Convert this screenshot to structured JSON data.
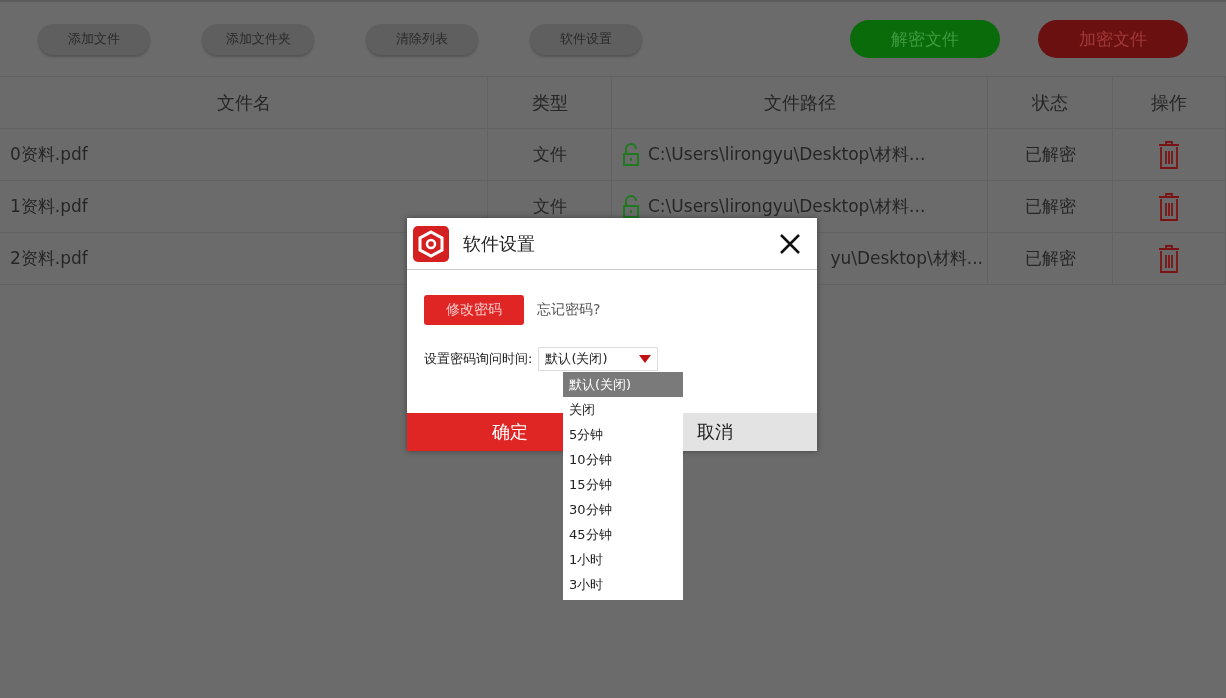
{
  "toolbar": {
    "buttons": [
      "添加文件",
      "添加文件夹",
      "清除列表",
      "软件设置"
    ],
    "decrypt_button": "解密文件",
    "encrypt_button": "加密文件"
  },
  "table": {
    "columns": [
      "文件名",
      "类型",
      "文件路径",
      "状态",
      "操作"
    ],
    "rows": [
      {
        "name": "0资料.pdf",
        "type": "文件",
        "path": "C:\\Users\\lirongyu\\Desktop\\材料...",
        "status": "已解密"
      },
      {
        "name": "1资料.pdf",
        "type": "文件",
        "path": "C:\\Users\\lirongyu\\Desktop\\材料...",
        "status": "已解密"
      },
      {
        "name": "2资料.pdf",
        "path": "yu\\Desktop\\材料...",
        "status": "已解密"
      }
    ]
  },
  "dialog": {
    "title": "软件设置",
    "change_password_button": "修改密码",
    "forgot_password_link": "忘记密码?",
    "ask_time_label": "设置密码询问时间:",
    "ask_time_value": "默认(关闭)",
    "options": [
      {
        "label": "默认(关闭)",
        "selected": true
      },
      {
        "label": "关闭",
        "selected": false
      },
      {
        "label": "5分钟",
        "selected": false
      },
      {
        "label": "10分钟",
        "selected": false
      },
      {
        "label": "15分钟",
        "selected": false
      },
      {
        "label": "30分钟",
        "selected": false
      },
      {
        "label": "45分钟",
        "selected": false
      },
      {
        "label": "1小时",
        "selected": false
      },
      {
        "label": "3小时",
        "selected": false
      }
    ],
    "ok_button": "确定",
    "cancel_button": "取消"
  }
}
